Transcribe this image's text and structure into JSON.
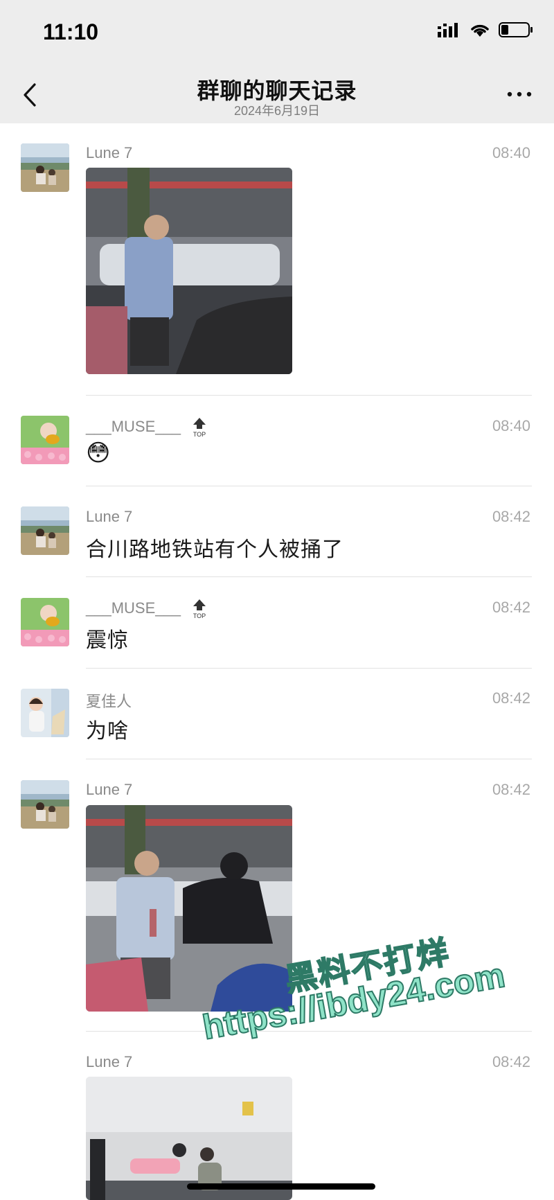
{
  "status_bar": {
    "time": "11:10"
  },
  "header": {
    "title": "群聊的聊天记录",
    "date": "2024年6月19日"
  },
  "messages": [
    {
      "sender": "Lune 7",
      "time": "08:40",
      "kind": "image"
    },
    {
      "sender": "___MUSE___",
      "time": "08:40",
      "kind": "emoji",
      "badge": "TOP",
      "emoji": "😳"
    },
    {
      "sender": "Lune 7",
      "time": "08:42",
      "kind": "text",
      "text": "合川路地铁站有个人被捅了"
    },
    {
      "sender": "___MUSE___",
      "time": "08:42",
      "kind": "text",
      "badge": "TOP",
      "text": "震惊"
    },
    {
      "sender": "夏佳人",
      "time": "08:42",
      "kind": "text",
      "text": "为啥"
    },
    {
      "sender": "Lune 7",
      "time": "08:42",
      "kind": "image"
    },
    {
      "sender": "Lune 7",
      "time": "08:42",
      "kind": "image"
    }
  ],
  "watermark": {
    "line1": "黑料不打烊",
    "line2": "https://ibdy24.com"
  },
  "colors": {
    "header_bg": "#ededed",
    "divider": "#e2e2e2",
    "watermark": "#8fe3c8"
  }
}
